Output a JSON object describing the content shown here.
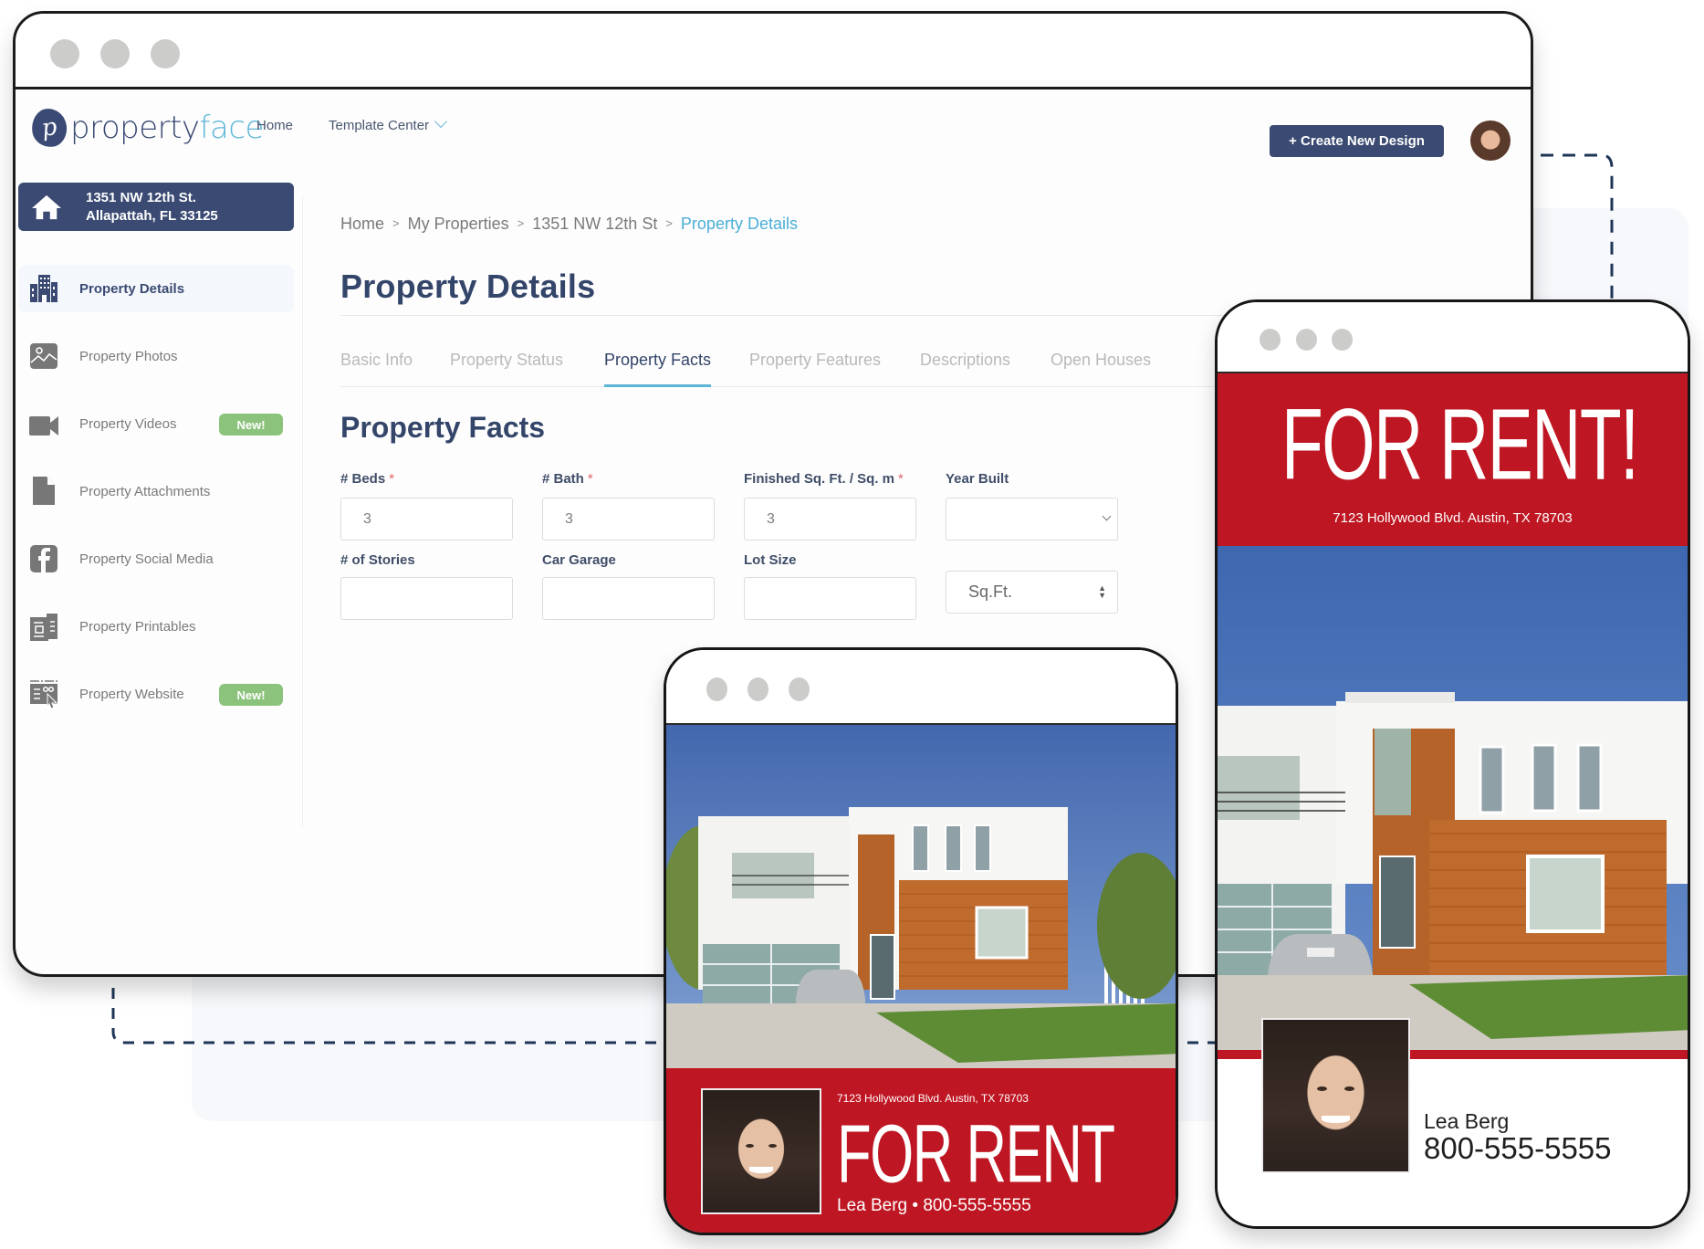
{
  "app": {
    "brand_a": "property",
    "brand_b": "face",
    "logo_letter": "p"
  },
  "nav": {
    "home": "Home",
    "template_center": "Template Center",
    "create_button": "+ Create New Design"
  },
  "sidebar": {
    "address_line1": "1351 NW 12th St.",
    "address_line2": "Allapattah, FL 33125",
    "items": [
      {
        "label": "Property Details",
        "icon": "buildings-icon",
        "active": true
      },
      {
        "label": "Property Photos",
        "icon": "image-icon"
      },
      {
        "label": "Property Videos",
        "icon": "video-camera-icon",
        "badge": "New!"
      },
      {
        "label": "Property Attachments",
        "icon": "document-icon"
      },
      {
        "label": "Property Social Media",
        "icon": "facebook-icon"
      },
      {
        "label": "Property Printables",
        "icon": "printables-icon"
      },
      {
        "label": "Property Website",
        "icon": "website-icon",
        "badge": "New!"
      }
    ]
  },
  "breadcrumb": {
    "items": [
      "Home",
      "My Properties",
      "1351 NW 12th St",
      "Property Details"
    ],
    "separator": ">"
  },
  "page": {
    "title": "Property Details",
    "tabs": [
      "Basic Info",
      "Property Status",
      "Property Facts",
      "Property Features",
      "Descriptions",
      "Open Houses"
    ],
    "active_tab": "Property Facts",
    "section_title": "Property Facts"
  },
  "form": {
    "required_mark": "*",
    "beds": {
      "label": "# Beds",
      "value": "3",
      "required": true
    },
    "bath": {
      "label": "# Bath",
      "value": "3",
      "required": true
    },
    "sqft": {
      "label": "Finished Sq. Ft. / Sq. m",
      "value": "3",
      "required": true
    },
    "year_built": {
      "label": "Year Built",
      "value": ""
    },
    "stories": {
      "label": "# of Stories",
      "value": ""
    },
    "garage": {
      "label": "Car Garage",
      "value": ""
    },
    "lot_size": {
      "label": "Lot Size",
      "value": ""
    },
    "lot_unit": {
      "value": "Sq.Ft."
    }
  },
  "flyer_small": {
    "address": "7123 Hollywood Blvd. Austin, TX 78703",
    "headline": "FOR RENT",
    "agent_line": "Lea Berg • 800-555-5555"
  },
  "flyer_large": {
    "headline": "FOR RENT!",
    "address": "7123 Hollywood Blvd. Austin, TX 78703",
    "agent_name": "Lea Berg",
    "agent_phone": "800-555-5555"
  },
  "colors": {
    "brand_navy": "#3a4a72",
    "accent_blue": "#5ab5d6",
    "badge_green": "#8cc37c",
    "flyer_red": "#be1622"
  }
}
